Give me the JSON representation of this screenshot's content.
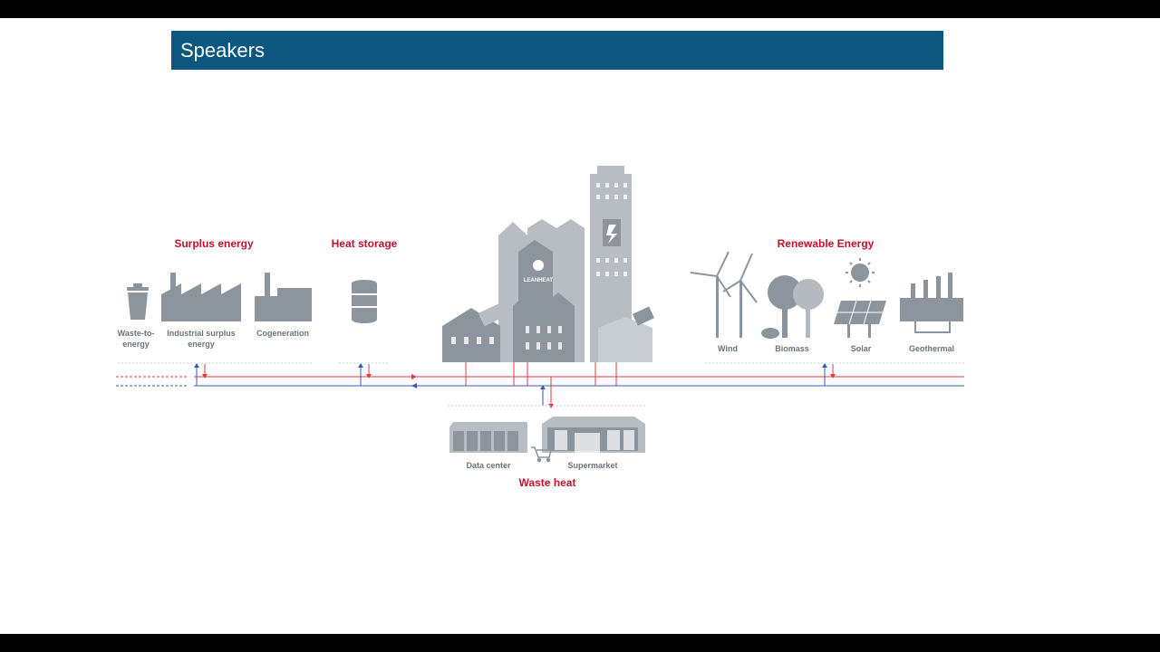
{
  "slide": {
    "title": "Speakers"
  },
  "diagram": {
    "groups": {
      "surplus": "Surplus energy",
      "storage": "Heat storage",
      "renewable": "Renewable Energy",
      "waste": "Waste heat"
    },
    "labels": {
      "waste_to_energy_1": "Waste-to-",
      "waste_to_energy_2": "energy",
      "industrial_1": "Industrial surplus",
      "industrial_2": "energy",
      "cogeneration": "Cogeneration",
      "wind": "Wind",
      "biomass": "Biomass",
      "solar": "Solar",
      "geothermal": "Geothermal",
      "data_center": "Data center",
      "supermarket": "Supermarket",
      "brand": "LEANHEAT"
    },
    "colors": {
      "accent_red": "#c8102e",
      "supply_line": "#e03a4a",
      "return_line": "#3a5aa8",
      "icon_gray": "#8c959d",
      "title_bar": "#0b577f"
    }
  }
}
